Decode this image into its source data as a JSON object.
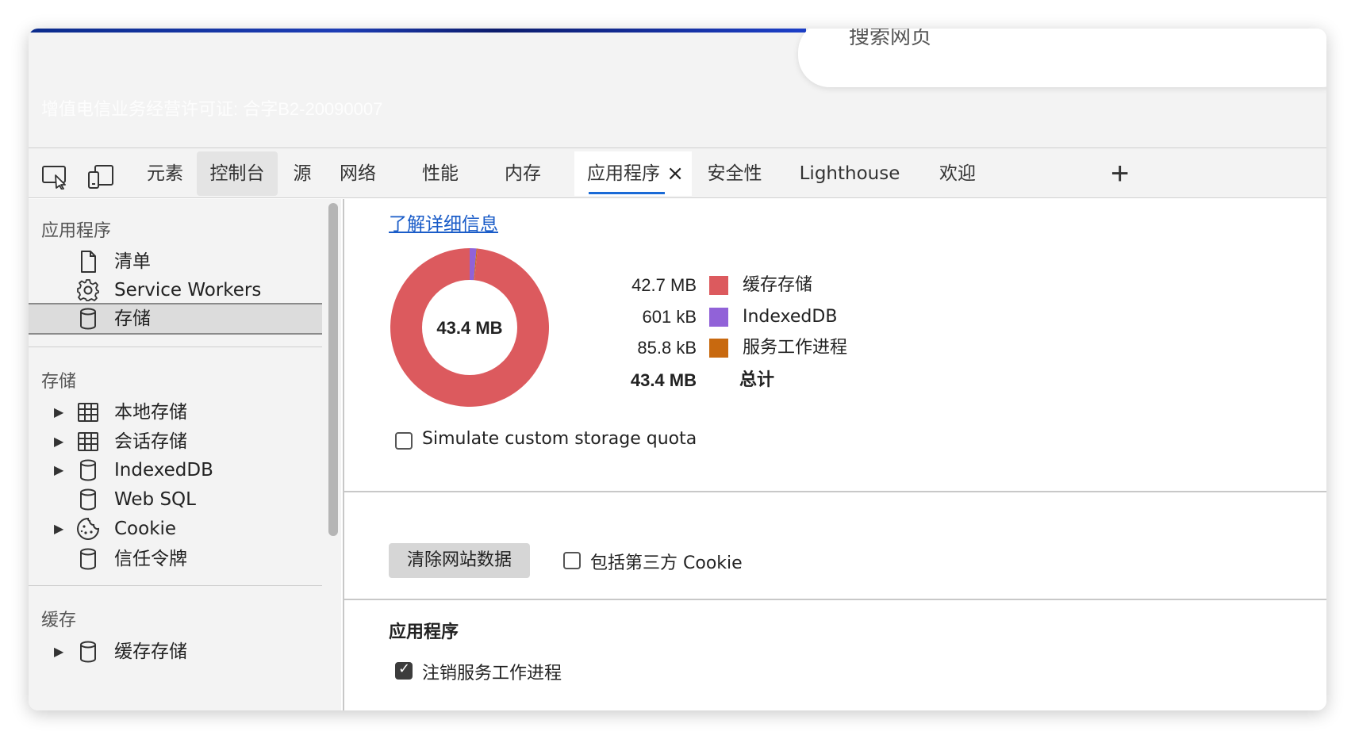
{
  "browser": {
    "search_text": "搜索网页",
    "license_text": "增值电信业务经营许可证: 合字B2-20090007"
  },
  "devtools": {
    "tabs": [
      {
        "label": "元素"
      },
      {
        "label": "控制台"
      },
      {
        "label": "源"
      },
      {
        "label": "网络"
      },
      {
        "label": "性能"
      },
      {
        "label": "内存"
      },
      {
        "label": "应用程序"
      },
      {
        "label": "安全性"
      },
      {
        "label": "Lighthouse"
      },
      {
        "label": "欢迎"
      }
    ],
    "active_tab_close": "×",
    "add_tab": "+"
  },
  "sidebar": {
    "app_header": "应用程序",
    "app_items": [
      {
        "label": "清单",
        "icon": "file-icon"
      },
      {
        "label": "Service Workers",
        "icon": "gear-icon"
      },
      {
        "label": "存储",
        "icon": "database-icon"
      }
    ],
    "storage_header": "存储",
    "storage_items": [
      {
        "label": "本地存储",
        "icon": "table-icon",
        "expandable": true
      },
      {
        "label": "会话存储",
        "icon": "table-icon",
        "expandable": true
      },
      {
        "label": "IndexedDB",
        "icon": "database-icon",
        "expandable": true
      },
      {
        "label": "Web SQL",
        "icon": "database-icon",
        "expandable": false
      },
      {
        "label": "Cookie",
        "icon": "cookie-icon",
        "expandable": true
      },
      {
        "label": "信任令牌",
        "icon": "database-icon",
        "expandable": false
      }
    ],
    "cache_header": "缓存",
    "cache_items": [
      {
        "label": "缓存存储",
        "icon": "database-icon",
        "expandable": true
      }
    ],
    "arrow": "▶"
  },
  "main": {
    "learn_more": "了解详细信息",
    "donut_center": "43.4 MB",
    "legend": [
      {
        "value": "42.7 MB",
        "label": "缓存存储",
        "color": "#dc5a5e"
      },
      {
        "value": "601 kB",
        "label": "IndexedDB",
        "color": "#9162d8"
      },
      {
        "value": "85.8 kB",
        "label": "服务工作进程",
        "color": "#c8690f"
      }
    ],
    "total": {
      "value": "43.4 MB",
      "label": "总计"
    },
    "simulate_quota": "Simulate custom storage quota",
    "clear_button": "清除网站数据",
    "include_third_party": "包括第三方 Cookie",
    "app_section_title": "应用程序",
    "unregister_sw": "注销服务工作进程"
  },
  "chart_data": {
    "type": "pie",
    "categories": [
      "缓存存储",
      "IndexedDB",
      "服务工作进程"
    ],
    "values": [
      42.7,
      0.601,
      0.0858
    ],
    "unit": "MB",
    "colors": [
      "#dc5a5e",
      "#9162d8",
      "#c8690f"
    ]
  }
}
